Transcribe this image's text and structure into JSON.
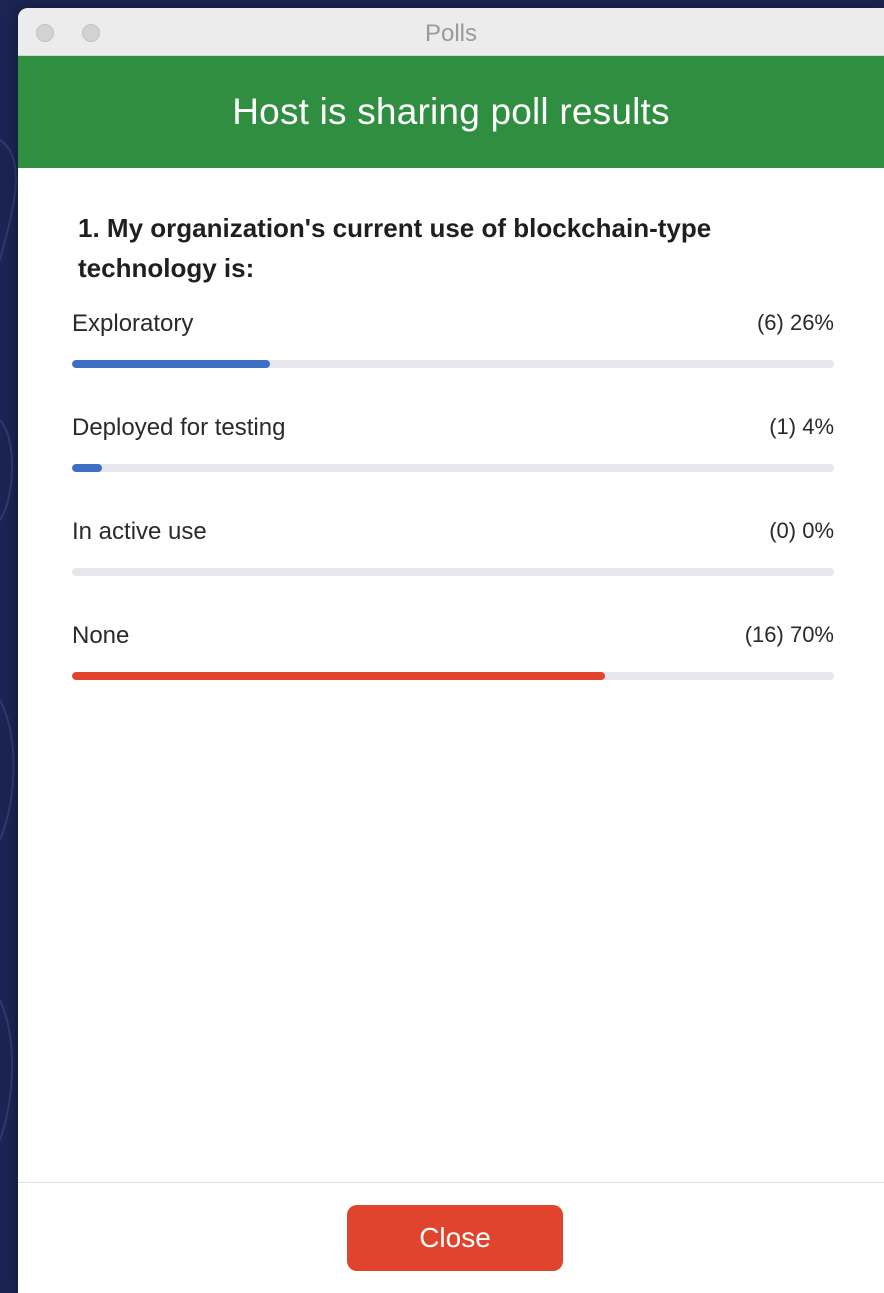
{
  "window": {
    "title": "Polls"
  },
  "banner": {
    "text": "Host is sharing poll results",
    "color": "#2f8e3f"
  },
  "poll": {
    "question": "1. My organization's current use of blockchain-type technology is:",
    "options": [
      {
        "label": "Exploratory",
        "result": "(6) 26%",
        "percent": 26,
        "color": "#3c6fc0"
      },
      {
        "label": "Deployed for testing",
        "result": "(1) 4%",
        "percent": 4,
        "color": "#3c6fc0"
      },
      {
        "label": "In active use",
        "result": "(0) 0%",
        "percent": 0,
        "color": "#3c6fc0"
      },
      {
        "label": "None",
        "result": "(16) 70%",
        "percent": 70,
        "color": "#e0442c"
      }
    ]
  },
  "footer": {
    "close_label": "Close",
    "close_color": "#e0442c"
  }
}
